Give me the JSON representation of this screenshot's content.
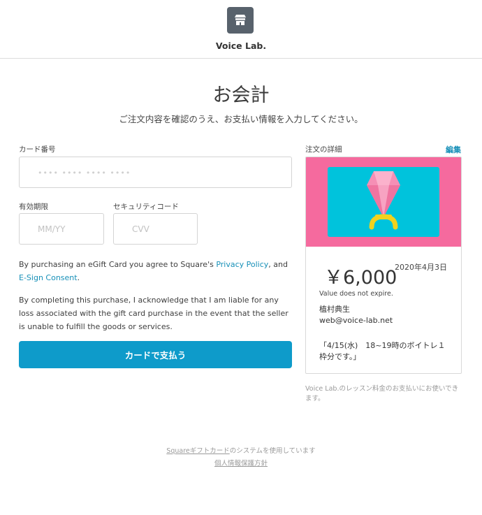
{
  "header": {
    "brand_name": "Voice Lab.",
    "logo_icon": "storefront-icon"
  },
  "main": {
    "title": "お会計",
    "subtitle": "ご注文内容を確認のうえ、お支払い情報を入力してください。"
  },
  "form": {
    "card_number_label": "カード番号",
    "card_number_placeholder": "•••• •••• •••• ••••",
    "expiration_label": "有効期限",
    "expiration_placeholder": "MM/YY",
    "security_code_label": "セキュリティコード",
    "security_code_placeholder": "CVV",
    "terms": {
      "prefix": "By purchasing an eGift Card you agree to Square's ",
      "privacy_link": "Privacy Policy",
      "middle": ", and ",
      "esign_link": "E-Sign Consent",
      "suffix": "."
    },
    "liability_text": "By completing this purchase, I acknowledge that I am liable for any loss associated with the gift card purchase in the event that the seller is unable to fulfill the goods or services.",
    "pay_button": "カードで支払う"
  },
  "order": {
    "details_label": "注文の詳細",
    "edit_link": "編集",
    "card_image_icon": "diamond-ring-icon",
    "amount": "￥6,000",
    "date": "2020年4月3日",
    "expiry_note": "Value does not expire.",
    "recipient_name": "植村典生",
    "recipient_email": "web@voice-lab.net",
    "message": "「4/15(水)　18~19時のボイトレ１枠分です。」",
    "note": "Voice Lab.のレッスン料金のお支払いにお使いできます。"
  },
  "footer": {
    "square_link": "Squareギフトカード",
    "powered_text": "のシステムを使用しています",
    "privacy_link": "個人情報保護方針"
  },
  "colors": {
    "accent": "#0e9bca",
    "link": "#1790b8",
    "gift_background": "#f56a9e",
    "gift_inner": "#00c3dc",
    "logo_background": "#58626c"
  }
}
